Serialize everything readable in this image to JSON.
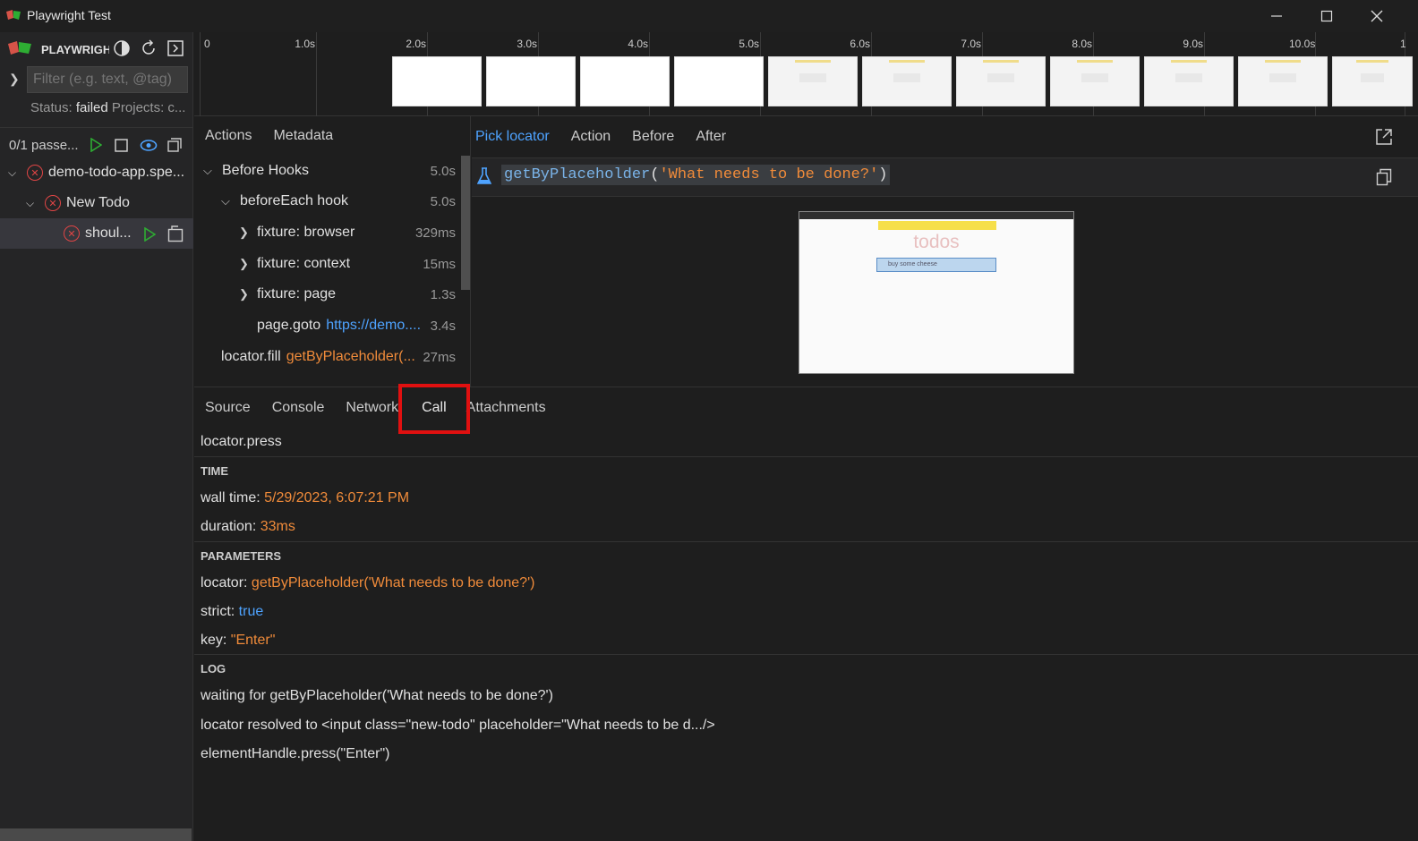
{
  "window": {
    "title": "Playwright Test"
  },
  "sidebar": {
    "brand": "PLAYWRIGHT",
    "filter_placeholder": "Filter (e.g. text, @tag)",
    "status_label": "Status:",
    "status_value": "failed",
    "projects_label": "Projects: c...",
    "pass_summary": "0/1 passe...",
    "tree": [
      {
        "label": "demo-todo-app.spe..."
      },
      {
        "label": "New Todo"
      },
      {
        "label": "shoul..."
      }
    ]
  },
  "timeline": {
    "ticks": [
      "0",
      "1.0s",
      "2.0s",
      "3.0s",
      "4.0s",
      "5.0s",
      "6.0s",
      "7.0s",
      "8.0s",
      "9.0s",
      "10.0s",
      "1"
    ]
  },
  "actions_panel": {
    "tabs": [
      "Actions",
      "Metadata"
    ],
    "rows": [
      {
        "label": "Before Hooks",
        "duration": "5.0s"
      },
      {
        "label": "beforeEach hook",
        "duration": "5.0s"
      },
      {
        "label": "fixture: browser",
        "duration": "329ms"
      },
      {
        "label": "fixture: context",
        "duration": "15ms"
      },
      {
        "label": "fixture: page",
        "duration": "1.3s"
      },
      {
        "label": "page.goto",
        "link": "https://demo....",
        "duration": "3.4s"
      },
      {
        "label": "locator.fill",
        "selector": "getByPlaceholder(...",
        "duration": "27ms"
      }
    ]
  },
  "snapshot_panel": {
    "tabs": [
      "Pick locator",
      "Action",
      "Before",
      "After"
    ],
    "locator": {
      "fn": "getByPlaceholder",
      "open": "(",
      "arg": "'What needs to be done?'",
      "close": ")"
    },
    "preview": {
      "title": "todos",
      "input_text": "buy some cheese"
    }
  },
  "details_panel": {
    "tabs": [
      "Source",
      "Console",
      "Network",
      "Call",
      "Attachments"
    ],
    "call_title": "locator.press",
    "time": {
      "heading": "TIME",
      "wall_time_label": "wall time:",
      "wall_time_value": "5/29/2023, 6:07:21 PM",
      "duration_label": "duration:",
      "duration_value": "33ms"
    },
    "parameters": {
      "heading": "PARAMETERS",
      "locator_label": "locator:",
      "locator_value": "getByPlaceholder('What needs to be done?')",
      "strict_label": "strict:",
      "strict_value": "true",
      "key_label": "key:",
      "key_value": "\"Enter\""
    },
    "log": {
      "heading": "LOG",
      "lines": [
        "waiting for getByPlaceholder('What needs to be done?')",
        "locator resolved to <input class=\"new-todo\" placeholder=\"What needs to be d.../>",
        "elementHandle.press(\"Enter\")"
      ]
    }
  },
  "colors": {
    "accent": "#4ea3ff",
    "value": "#f08b3a",
    "error": "#e04545",
    "highlight": "#e01010"
  }
}
